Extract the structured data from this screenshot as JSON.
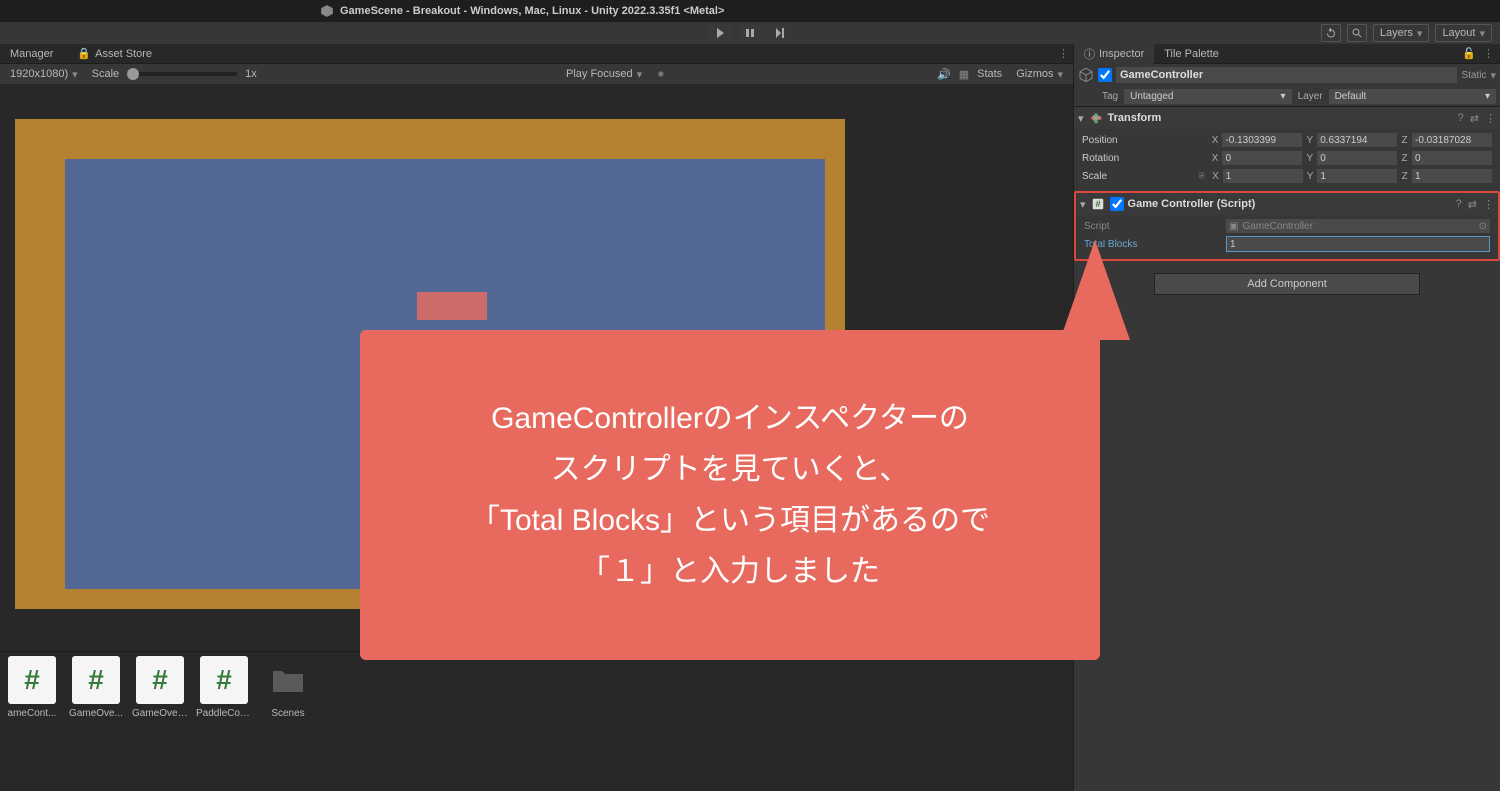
{
  "window": {
    "title": "GameScene - Breakout - Windows, Mac, Linux - Unity 2022.3.35f1 <Metal>"
  },
  "playbackBar": {
    "layers": "Layers",
    "layout": "Layout"
  },
  "tabs": {
    "manager": "Manager",
    "assetStore": "Asset Store"
  },
  "gameToolbar": {
    "resolution": "1920x1080)",
    "scale": "Scale",
    "scaleValue": "1x",
    "playFocused": "Play Focused",
    "stats": "Stats",
    "gizmos": "Gizmos"
  },
  "assets": [
    {
      "icon": "#",
      "label": "ameCont..."
    },
    {
      "icon": "#",
      "label": "GameOve..."
    },
    {
      "icon": "#",
      "label": "GameOver..."
    },
    {
      "icon": "#",
      "label": "PaddleCon..."
    },
    {
      "icon": "folder",
      "label": "Scenes"
    }
  ],
  "inspector": {
    "tabInspector": "Inspector",
    "tabTilePalette": "Tile Palette",
    "objectName": "GameController",
    "staticLabel": "Static",
    "tagLabel": "Tag",
    "tagValue": "Untagged",
    "layerLabel": "Layer",
    "layerValue": "Default",
    "transform": {
      "title": "Transform",
      "position": "Position",
      "rotation": "Rotation",
      "scale": "Scale",
      "posX": "-0.1303399",
      "posY": "0.6337194",
      "posZ": "-0.03187028",
      "rotX": "0",
      "rotY": "0",
      "rotZ": "0",
      "scaleX": "1",
      "scaleY": "1",
      "scaleZ": "1"
    },
    "scriptComp": {
      "title": "Game Controller (Script)",
      "scriptLabel": "Script",
      "scriptValue": "GameController",
      "totalBlocksLabel": "Total Blocks",
      "totalBlocksValue": "1"
    },
    "addComponent": "Add Component"
  },
  "callout": {
    "text": "GameControllerのインスペクターの\nスクリプトを見ていくと、\n「Total Blocks」という項目があるので\n「１」と入力しました"
  }
}
